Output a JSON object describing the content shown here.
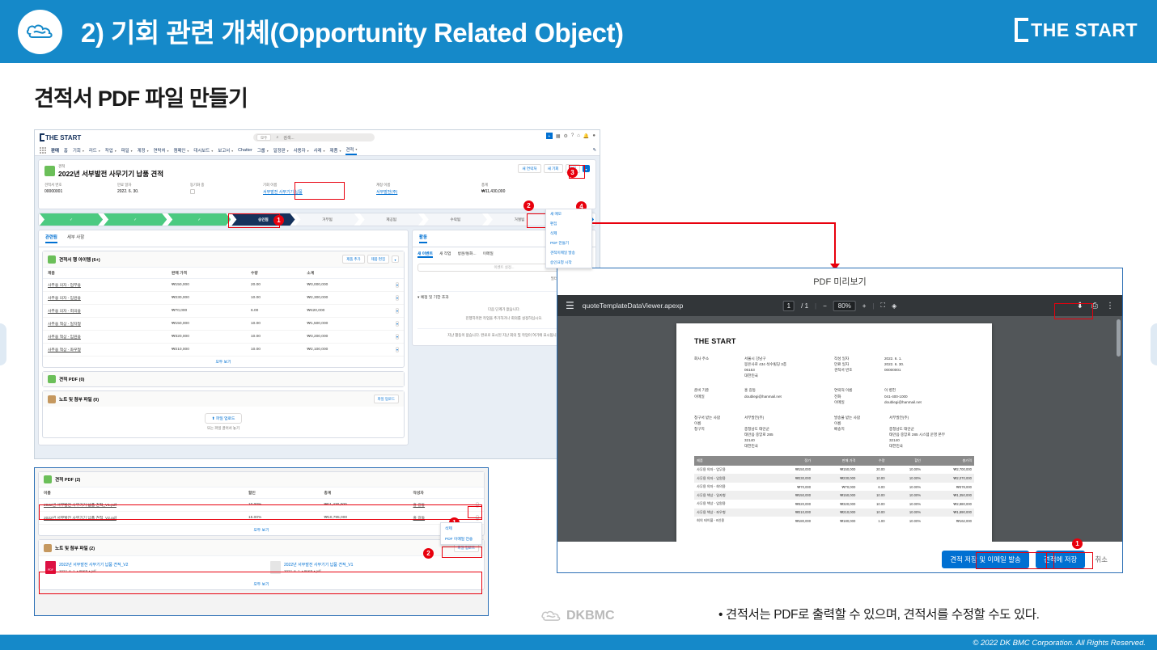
{
  "slide": {
    "header_title": "2) 기회 관련 개체(Opportunity Related Object)",
    "logo_text": "THE START",
    "section_title": "견적서 PDF 파일 만들기",
    "bullet_note": "• 견적서는 PDF로 출력할 수 있으며, 견적서를 수정할 수도 있다.",
    "footer_logo": "DKBMC",
    "copyright": "© 2022 DK BMC Corporation. All Rights Reserved.",
    "accent_color": "#1589c9",
    "annotation_color": "#e8000d"
  },
  "salesforce": {
    "org_logo": "THE START",
    "search_scope": "모두",
    "search_placeholder": "검색...",
    "app_name": "판매",
    "nav_items": [
      "홈",
      "기회",
      "리드",
      "작업",
      "파일",
      "계정",
      "연락처",
      "캠페인",
      "대시보드",
      "보고서",
      "Chatter",
      "그룹",
      "일정판",
      "사용자",
      "사례",
      "제품",
      "견적"
    ],
    "nav_active": "견적",
    "record": {
      "kind": "견적",
      "name": "2022년 서부발전 사무기기 납품 견적",
      "header_buttons": [
        "새 연락처",
        "새 기회",
        "편집"
      ],
      "fields": [
        {
          "label": "견적서 번호",
          "value": "00000001"
        },
        {
          "label": "만료 일자",
          "value": "2022. 6. 30."
        },
        {
          "label": "동기화 중",
          "value": ""
        },
        {
          "label": "기회 이름",
          "value": "서부발전 사무기기 납품",
          "link": true
        },
        {
          "label": "계정 이름",
          "value": "서부발전(주)",
          "link": true
        },
        {
          "label": "총계",
          "value": "₩11,430,000"
        }
      ]
    },
    "path_stages": [
      {
        "label": "✓",
        "state": "done"
      },
      {
        "label": "✓",
        "state": "done"
      },
      {
        "label": "✓",
        "state": "done"
      },
      {
        "label": "승인됨",
        "state": "current"
      },
      {
        "label": "거부됨",
        "state": "todo"
      },
      {
        "label": "제공됨",
        "state": "todo"
      },
      {
        "label": "수락됨",
        "state": "todo"
      },
      {
        "label": "거절됨",
        "state": "todo"
      },
      {
        "label": "✓ 현재 단계로 표시",
        "state": "mark"
      }
    ],
    "header_menu": [
      "새 메모",
      "편집",
      "삭제",
      "PDF 만들기",
      "견적이메일 발송",
      "승인요청 시작"
    ],
    "tabs": [
      "관련됨",
      "세부 사항"
    ],
    "tab_active": "관련됨",
    "line_items": {
      "title": "견적서 행 아이템 (6+)",
      "buttons": [
        "제품 추가",
        "제품 편집"
      ],
      "columns": [
        "제품",
        "판매 가격",
        "수량",
        "소계"
      ],
      "rows": [
        [
          "사무용 의자 - 업무용",
          "₩150,000",
          "20.00",
          "₩3,000,000"
        ],
        [
          "사무용 의자 - 임원용",
          "₩230,000",
          "10.00",
          "₩2,300,000"
        ],
        [
          "사무용 의자 - 회의용",
          "₩70,000",
          "6.00",
          "₩420,000"
        ],
        [
          "사무용 책상 - 일자형",
          "₩150,000",
          "10.00",
          "₩1,500,000"
        ],
        [
          "사무용 책상 - 임원용",
          "₩320,000",
          "10.00",
          "₩3,200,000"
        ],
        [
          "사무용 책상 - 좌우형",
          "₩210,000",
          "10.00",
          "₩2,100,000"
        ]
      ],
      "view_all": "모두 보기"
    },
    "quote_pdf_empty": {
      "title": "견적 PDF (0)"
    },
    "notes_empty": {
      "title": "노트 및 첨부 파일 (0)",
      "button": "파일 업로드",
      "drop_button": "파일 업로드",
      "drop_hint": "또는 파일 끌어서 놓기"
    },
    "activity": {
      "title": "활동",
      "tabs": [
        "새 이벤트",
        "새 작업",
        "방문/통화...",
        "이메일"
      ],
      "tab_active": "새 이벤트",
      "input_placeholder": "이벤트 설정...",
      "filter_note": "필터: 모든 시간 • 모든 활동",
      "filter_links": "새로 고침 • 확장",
      "section": "예정 및 기한 초과",
      "empty_1": "다음 단계가 없습니다.",
      "empty_2": "진행하려면 작업을 추가하거나 회의를 설정하십시오.",
      "empty_3": "지난 활동이 없습니다. 완료로 표시된 지난 회의 및 작업이 여기에 표시됩니다."
    }
  },
  "salesforce_bottom": {
    "quote_pdf": {
      "title": "견적 PDF (2)",
      "columns": [
        "이름",
        "할인",
        "총계",
        "작성자"
      ],
      "rows": [
        [
          "2022년 서부발전 사무기기 납품 견적_V1.pdf",
          "10.00%",
          "₩11,430,000",
          "홍 길동"
        ],
        [
          "2022년 서부발전 사무기기 납품 견적_V2.pdf",
          "15.00%",
          "₩10,795,000",
          "홍 길동"
        ]
      ],
      "view_all": "모두 보기",
      "row_menu": [
        "삭제",
        "PDF 이메일 전송"
      ]
    },
    "notes": {
      "title": "노트 및 첨부 파일 (2)",
      "button": "파일 업로드",
      "files": [
        {
          "name": "2022년 서부발전 사무기기 납품 견적_V2",
          "meta": "2022. 6. 1. • 88KB • pdf",
          "type": "pdf"
        },
        {
          "name": "2022년 서부발전 사무기기 납품 견적_V1",
          "meta": "2022. 6. 1. • 86KB • pdf",
          "type": "file"
        }
      ],
      "view_all": "모두 보기"
    }
  },
  "pdf_dialog": {
    "title": "PDF 미리보기",
    "toolbar": {
      "filename": "quoteTemplateDataViewer.apexp",
      "page_current": "1",
      "page_total": "1",
      "zoom": "80%"
    },
    "document": {
      "brand": "THE START",
      "left_fields": [
        {
          "label": "회사 주소",
          "values": [
            "서울시 강남구",
            "봉은사로 434 석수빌딩 3층",
            "06153",
            "대한민국"
          ]
        },
        {
          "label": "준비 기준",
          "values": [
            "홍 길동"
          ]
        },
        {
          "label": "이메일",
          "values": [
            "doublegi@hanmail.net"
          ]
        }
      ],
      "right_fields": [
        {
          "label": "작성 일자",
          "values": [
            "2022. 6. 1."
          ]
        },
        {
          "label": "만료 일자",
          "values": [
            "2022. 6. 30."
          ]
        },
        {
          "label": "견적서 번호",
          "values": [
            "00000001"
          ]
        },
        {
          "label": "연락처 이름",
          "values": [
            "이 병헌"
          ]
        },
        {
          "label": "전화",
          "values": [
            "041-400-1000"
          ]
        },
        {
          "label": "이메일",
          "values": [
            "doublegi@hanmail.net"
          ]
        }
      ],
      "bill_to": {
        "label1": "청구서 받는 사람",
        "value1": "서부발전(주)",
        "label2": "이름",
        "value2": "",
        "label3": "청구지",
        "values": [
          "충청남도 태안군",
          "태안읍 중앙로 285",
          "32140",
          "대한민국"
        ]
      },
      "ship_to": {
        "label1": "발송물 받는 사람",
        "value1": "서부발전(주)",
        "label2": "이름",
        "value2": "",
        "label3": "배송지",
        "values": [
          "충청남도 태안군",
          "태안읍 중앙로 285 시스템 운영 본부",
          "32140",
          "대한민국"
        ]
      },
      "table": {
        "columns": [
          "제품",
          "정가",
          "판매 가격",
          "수량",
          "할인",
          "총가격"
        ],
        "rows": [
          [
            "사무용 의자 - 업무용",
            "₩150,000",
            "₩150,000",
            "20.00",
            "10.00%",
            "₩2,700,000"
          ],
          [
            "사무용 의자 - 임원용",
            "₩230,000",
            "₩230,000",
            "10.00",
            "10.00%",
            "₩2,070,000"
          ],
          [
            "사무용 의자 - 회의용",
            "₩70,000",
            "₩70,000",
            "6.00",
            "10.00%",
            "₩378,000"
          ],
          [
            "사무용 책상 - 일자형",
            "₩150,000",
            "₩150,000",
            "10.00",
            "10.00%",
            "₩1,350,000"
          ],
          [
            "사무용 책상 - 임원용",
            "₩320,000",
            "₩320,000",
            "10.00",
            "10.00%",
            "₩2,880,000"
          ],
          [
            "사무용 책상 - 좌우형",
            "₩210,000",
            "₩210,000",
            "10.00",
            "10.00%",
            "₩1,890,000"
          ],
          [
            "회의 테이블 - 6인용",
            "₩180,000",
            "₩180,000",
            "1.00",
            "10.00%",
            "₩162,000"
          ]
        ]
      }
    },
    "footer_buttons": {
      "save_email": "견적 저장 및 이메일 발송",
      "save": "견적에 저장",
      "cancel": "취소"
    }
  },
  "annotations": {
    "n1": "1",
    "n2": "2",
    "n3": "3",
    "n4": "4"
  }
}
